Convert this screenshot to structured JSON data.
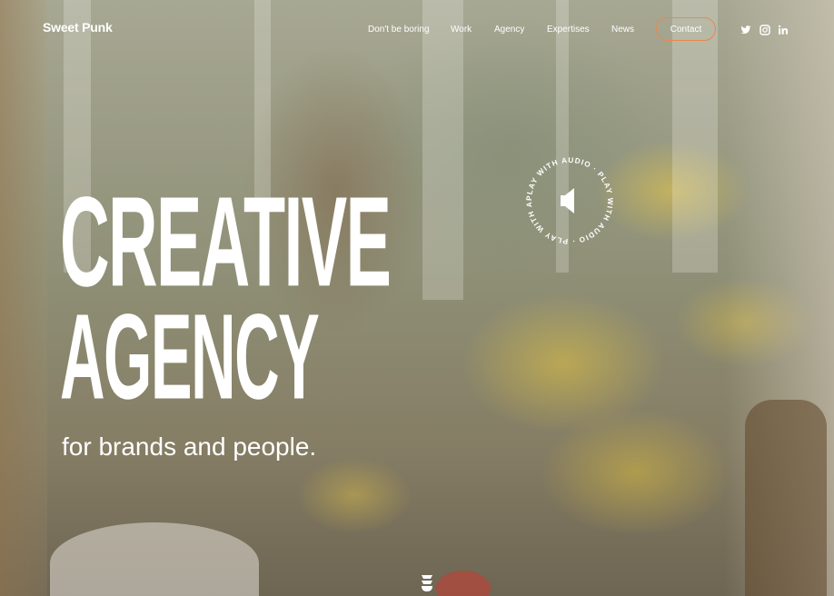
{
  "brand": {
    "logo_text": "Sweet Punk"
  },
  "nav": {
    "items": [
      {
        "label": "Don't be boring"
      },
      {
        "label": "Work"
      },
      {
        "label": "Agency"
      },
      {
        "label": "Expertises"
      },
      {
        "label": "News"
      }
    ],
    "contact_label": "Contact",
    "contact_border_color": "#e9884b",
    "social_icons": [
      "twitter-icon",
      "instagram-icon",
      "linkedin-icon"
    ]
  },
  "hero": {
    "headline_line1": "CREATIVE",
    "headline_line2": "AGENCY",
    "subline": "for brands and people.",
    "audio_badge_text": "PLAY WITH AUDIO · PLAY WITH AUDIO · PLAY WITH AUDIO ·",
    "audio_icon": "speaker-icon",
    "scroll_icon": "scroll-down-icon"
  }
}
